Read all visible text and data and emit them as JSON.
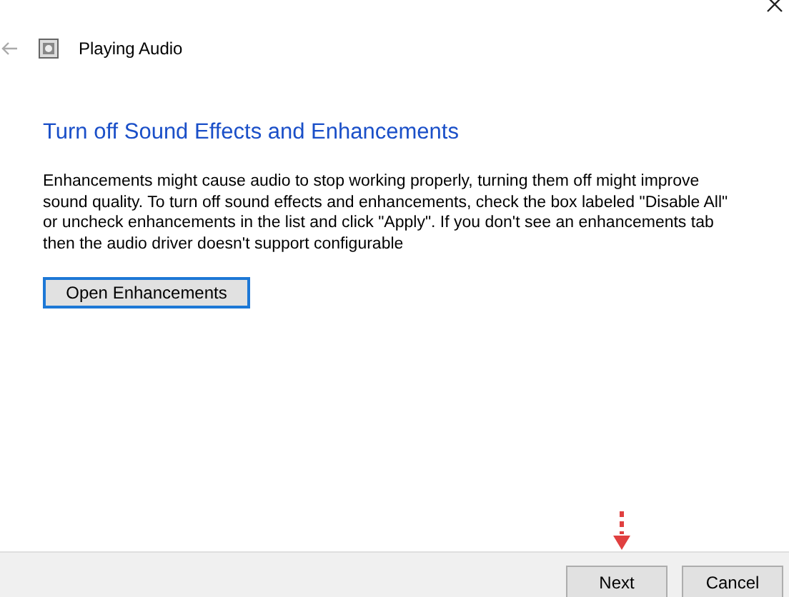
{
  "window": {
    "title": "Playing Audio"
  },
  "heading": "Turn off Sound Effects and Enhancements",
  "description": "Enhancements might cause audio to stop working properly, turning them off might improve sound quality. To turn off sound effects and enhancements, check the box labeled \"Disable All\" or uncheck enhancements in the list and click \"Apply\". If you don't see an enhancements tab then the audio driver doesn't support configurable",
  "action_button": "Open Enhancements",
  "buttons": [
    {
      "label": "Next"
    },
    {
      "label": "Cancel"
    }
  ]
}
